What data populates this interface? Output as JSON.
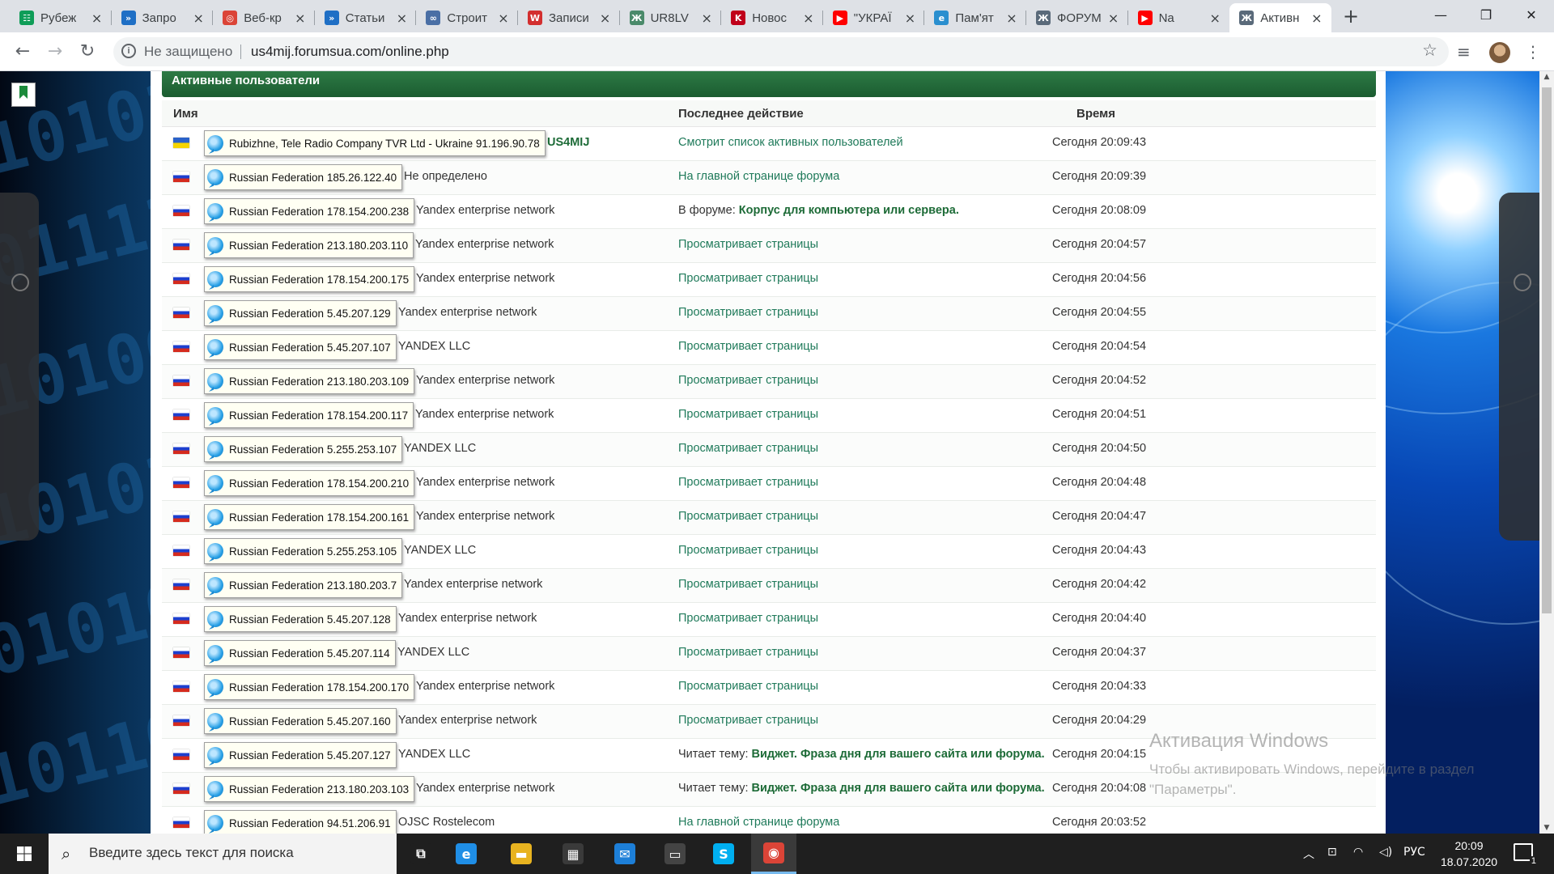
{
  "browser": {
    "tabs": [
      {
        "title": "Рубеж",
        "favicon": "grid-app-icon",
        "color": "#0f9d58",
        "letter": "☷"
      },
      {
        "title": "Запро",
        "favicon": "forum-icon",
        "color": "#1f6fc5",
        "letter": "»"
      },
      {
        "title": "Веб-кр",
        "favicon": "chrome-webstore-icon",
        "color": "#db4437",
        "letter": "◎"
      },
      {
        "title": "Статьи",
        "favicon": "forum-icon",
        "color": "#1f6fc5",
        "letter": "»"
      },
      {
        "title": "Строит",
        "favicon": "link-icon",
        "color": "#4a6fa5",
        "letter": "∞"
      },
      {
        "title": "Записи",
        "favicon": "red-circle-icon",
        "color": "#d32f2f",
        "letter": "W"
      },
      {
        "title": "UR8LV",
        "favicon": "antenna-icon",
        "color": "#4a8a6a",
        "letter": "Ж"
      },
      {
        "title": "Новос",
        "favicon": "k-logo-icon",
        "color": "#c0001a",
        "letter": "K"
      },
      {
        "title": "\"УКРАЇ",
        "favicon": "youtube-icon",
        "color": "#ff0000",
        "letter": "▶"
      },
      {
        "title": "Пам'ят",
        "favicon": "edge-icon",
        "color": "#2a8fcf",
        "letter": "e"
      },
      {
        "title": "ФОРУМ",
        "favicon": "tower-icon",
        "color": "#5a6a7a",
        "letter": "Ж"
      },
      {
        "title": "Na",
        "favicon": "youtube-icon",
        "color": "#ff0000",
        "letter": "▶"
      },
      {
        "title": "Активн",
        "favicon": "tower-icon",
        "color": "#5a6a7a",
        "letter": "Ж"
      }
    ],
    "active_tab_index": 12,
    "new_tab_label": "+",
    "security_label": "Не защищено",
    "url": "us4mij.forumsua.com/online.php"
  },
  "page": {
    "title": "Активные пользователи",
    "columns": {
      "name": "Имя",
      "action": "Последнее действие",
      "time": "Время"
    },
    "rows": [
      {
        "flag": "ua",
        "tooltip": "Rubizhne, Tele Radio Company TVR Ltd - Ukraine 91.196.90.78",
        "who": "US4MIJ",
        "who_is_user": true,
        "action_prefix": "",
        "action": "Смотрит список активных пользователей",
        "time": "Сегодня 20:09:43"
      },
      {
        "flag": "ru",
        "tooltip": "Russian Federation 185.26.122.40",
        "who": "Не определено",
        "action_prefix": "",
        "action": "На главной странице форума",
        "time": "Сегодня 20:09:39"
      },
      {
        "flag": "ru",
        "tooltip": "Russian Federation 178.154.200.238",
        "who": "Yandex enterprise network",
        "action_prefix": "В форуме: ",
        "action": "Корпус для компьютера или сервера.",
        "action_bold": true,
        "time": "Сегодня 20:08:09"
      },
      {
        "flag": "ru",
        "tooltip": "Russian Federation 213.180.203.110",
        "who": "Yandex enterprise network",
        "action_prefix": "",
        "action": "Просматривает страницы",
        "time": "Сегодня 20:04:57"
      },
      {
        "flag": "ru",
        "tooltip": "Russian Federation 178.154.200.175",
        "who": "Yandex enterprise network",
        "action_prefix": "",
        "action": "Просматривает страницы",
        "time": "Сегодня 20:04:56"
      },
      {
        "flag": "ru",
        "tooltip": "Russian Federation 5.45.207.129",
        "who": "Yandex enterprise network",
        "action_prefix": "",
        "action": "Просматривает страницы",
        "time": "Сегодня 20:04:55"
      },
      {
        "flag": "ru",
        "tooltip": "Russian Federation 5.45.207.107",
        "who": "YANDEX LLC",
        "action_prefix": "",
        "action": "Просматривает страницы",
        "time": "Сегодня 20:04:54"
      },
      {
        "flag": "ru",
        "tooltip": "Russian Federation 213.180.203.109",
        "who": "Yandex enterprise network",
        "action_prefix": "",
        "action": "Просматривает страницы",
        "time": "Сегодня 20:04:52"
      },
      {
        "flag": "ru",
        "tooltip": "Russian Federation 178.154.200.117",
        "who": "Yandex enterprise network",
        "action_prefix": "",
        "action": "Просматривает страницы",
        "time": "Сегодня 20:04:51"
      },
      {
        "flag": "ru",
        "tooltip": "Russian Federation 5.255.253.107",
        "who": "YANDEX LLC",
        "action_prefix": "",
        "action": "Просматривает страницы",
        "time": "Сегодня 20:04:50"
      },
      {
        "flag": "ru",
        "tooltip": "Russian Federation 178.154.200.210",
        "who": "Yandex enterprise network",
        "action_prefix": "",
        "action": "Просматривает страницы",
        "time": "Сегодня 20:04:48"
      },
      {
        "flag": "ru",
        "tooltip": "Russian Federation 178.154.200.161",
        "who": "Yandex enterprise network",
        "action_prefix": "",
        "action": "Просматривает страницы",
        "time": "Сегодня 20:04:47"
      },
      {
        "flag": "ru",
        "tooltip": "Russian Federation 5.255.253.105",
        "who": "YANDEX LLC",
        "action_prefix": "",
        "action": "Просматривает страницы",
        "time": "Сегодня 20:04:43"
      },
      {
        "flag": "ru",
        "tooltip": "Russian Federation 213.180.203.7",
        "who": "Yandex enterprise network",
        "action_prefix": "",
        "action": "Просматривает страницы",
        "time": "Сегодня 20:04:42"
      },
      {
        "flag": "ru",
        "tooltip": "Russian Federation 5.45.207.128",
        "who": "Yandex enterprise network",
        "action_prefix": "",
        "action": "Просматривает страницы",
        "time": "Сегодня 20:04:40"
      },
      {
        "flag": "ru",
        "tooltip": "Russian Federation 5.45.207.114",
        "who": "YANDEX LLC",
        "action_prefix": "",
        "action": "Просматривает страницы",
        "time": "Сегодня 20:04:37"
      },
      {
        "flag": "ru",
        "tooltip": "Russian Federation 178.154.200.170",
        "who": "Yandex enterprise network",
        "action_prefix": "",
        "action": "Просматривает страницы",
        "time": "Сегодня 20:04:33"
      },
      {
        "flag": "ru",
        "tooltip": "Russian Federation 5.45.207.160",
        "who": "Yandex enterprise network",
        "action_prefix": "",
        "action": "Просматривает страницы",
        "time": "Сегодня 20:04:29"
      },
      {
        "flag": "ru",
        "tooltip": "Russian Federation 5.45.207.127",
        "who": "YANDEX LLC",
        "action_prefix": "Читает тему: ",
        "action": "Виджет. Фраза дня для вашего сайта или форума.",
        "action_bold": true,
        "time": "Сегодня 20:04:15"
      },
      {
        "flag": "ru",
        "tooltip": "Russian Federation 213.180.203.103",
        "who": "Yandex enterprise network",
        "action_prefix": "Читает тему: ",
        "action": "Виджет. Фраза дня для вашего сайта или форума.",
        "action_bold": true,
        "time": "Сегодня 20:04:08"
      },
      {
        "flag": "ru",
        "tooltip": "Russian Federation 94.51.206.91",
        "who": "OJSC Rostelecom",
        "action_prefix": "",
        "action": "На главной странице форума",
        "time": "Сегодня 20:03:52"
      }
    ]
  },
  "watermark": {
    "title": "Активация Windows",
    "text": "Чтобы активировать Windows, перейдите в раздел \"Параметры\"."
  },
  "taskbar": {
    "search_placeholder": "Введите здесь текст для поиска",
    "apps": [
      {
        "name": "task-view-icon",
        "glyph": "⧉",
        "color": "#1f1f1f"
      },
      {
        "name": "edge-icon",
        "glyph": "e",
        "color": "#1f8ee6"
      },
      {
        "name": "file-explorer-icon",
        "glyph": "▬",
        "color": "#e8b320"
      },
      {
        "name": "store-icon",
        "glyph": "▦",
        "color": "#3a3a3a"
      },
      {
        "name": "mail-icon",
        "glyph": "✉",
        "color": "#1d7fd8"
      },
      {
        "name": "terminal-icon",
        "glyph": "▭",
        "color": "#444"
      },
      {
        "name": "skype-icon",
        "glyph": "S",
        "color": "#00aff0"
      },
      {
        "name": "chrome-icon",
        "glyph": "◉",
        "color": "#db4437"
      }
    ],
    "language": "РУС",
    "time": "20:09",
    "date": "18.07.2020",
    "notification_count": "1"
  }
}
